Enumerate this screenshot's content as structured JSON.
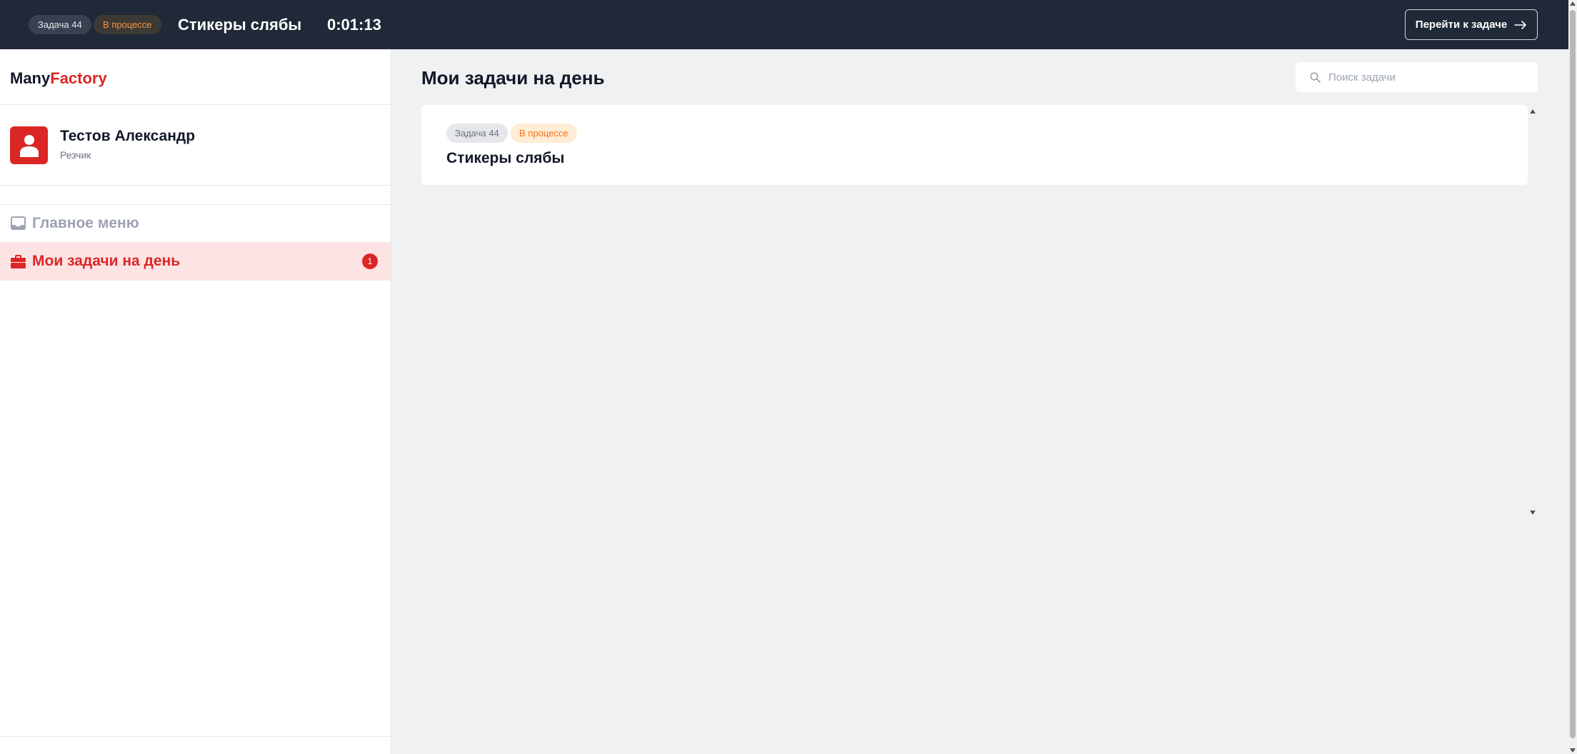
{
  "topbar": {
    "task_id": "Задача 44",
    "status": "В процессе",
    "title": "Стикеры слябы",
    "timer": "0:01:13",
    "go_button": "Перейти к задаче"
  },
  "sidebar": {
    "logo_part1": "Many",
    "logo_part2": "Factory",
    "user": {
      "name": "Тестов Александр",
      "role": "Резчик"
    },
    "nav": [
      {
        "label": "Главное меню",
        "icon": "inbox-icon"
      },
      {
        "label": "Мои задачи на день",
        "icon": "briefcase-icon",
        "count": "1"
      }
    ]
  },
  "main": {
    "title": "Мои задачи на день",
    "search_placeholder": "Поиск задачи",
    "tasks": [
      {
        "id": "Задача 44",
        "status": "В процессе",
        "title": "Стикеры слябы"
      }
    ]
  },
  "colors": {
    "accent": "#dc2626",
    "topbar_bg": "#1f2937",
    "status_orange": "#f97316"
  }
}
